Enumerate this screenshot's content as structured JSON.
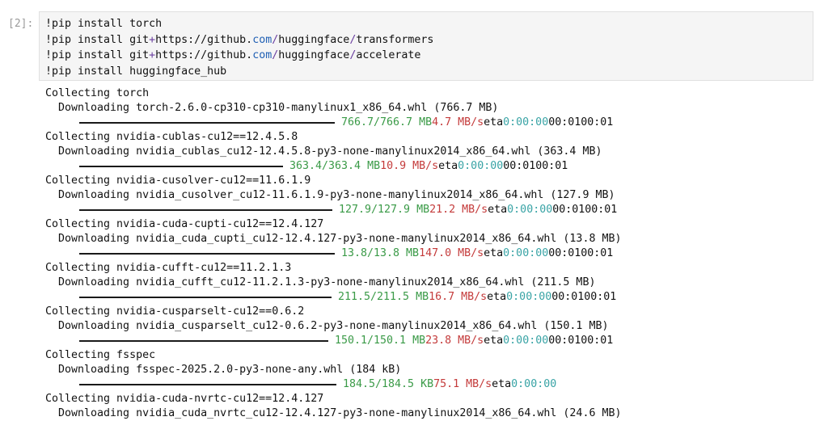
{
  "cell": {
    "prompt": "[2]:",
    "code_lines": [
      {
        "parts": [
          {
            "t": "!pip install torch",
            "c": ""
          }
        ]
      },
      {
        "parts": [
          {
            "t": "!pip install git",
            "c": ""
          },
          {
            "t": "+",
            "c": "plus"
          },
          {
            "t": "https://github.",
            "c": ""
          },
          {
            "t": "com",
            "c": "com"
          },
          {
            "t": "/",
            "c": "slash"
          },
          {
            "t": "huggingface",
            "c": ""
          },
          {
            "t": "/",
            "c": "slash"
          },
          {
            "t": "transformers",
            "c": ""
          }
        ]
      },
      {
        "parts": [
          {
            "t": "!pip install git",
            "c": ""
          },
          {
            "t": "+",
            "c": "plus"
          },
          {
            "t": "https://github.",
            "c": ""
          },
          {
            "t": "com",
            "c": "com"
          },
          {
            "t": "/",
            "c": "slash"
          },
          {
            "t": "huggingface",
            "c": ""
          },
          {
            "t": "/",
            "c": "slash"
          },
          {
            "t": "accelerate",
            "c": ""
          }
        ]
      },
      {
        "parts": [
          {
            "t": "!pip install huggingface_hub",
            "c": ""
          }
        ]
      }
    ]
  },
  "output": {
    "packages": [
      {
        "collecting": "Collecting torch",
        "downloading": "Downloading torch-2.6.0-cp310-cp310-manylinux1_x86_64.whl (766.7 MB)",
        "progress": "766.7/766.7 MB",
        "speed": "4.7 MB/s",
        "eta_label": "eta",
        "eta": "0:00:00",
        "tail": "00:0100:01"
      },
      {
        "collecting": "Collecting nvidia-cublas-cu12==12.4.5.8",
        "downloading": "Downloading nvidia_cublas_cu12-12.4.5.8-py3-none-manylinux2014_x86_64.whl (363.4 MB)",
        "progress": "363.4/363.4 MB",
        "speed": "10.9 MB/s",
        "eta_label": "eta",
        "eta": "0:00:00",
        "tail": "00:0100:01"
      },
      {
        "collecting": "Collecting nvidia-cusolver-cu12==11.6.1.9",
        "downloading": "Downloading nvidia_cusolver_cu12-11.6.1.9-py3-none-manylinux2014_x86_64.whl (127.9 MB)",
        "progress": "127.9/127.9 MB",
        "speed": "21.2 MB/s",
        "eta_label": "eta",
        "eta": "0:00:00",
        "tail": "00:0100:01"
      },
      {
        "collecting": "Collecting nvidia-cuda-cupti-cu12==12.4.127",
        "downloading": "Downloading nvidia_cuda_cupti_cu12-12.4.127-py3-none-manylinux2014_x86_64.whl (13.8 MB)",
        "progress": "13.8/13.8 MB",
        "speed": "147.0 MB/s",
        "eta_label": "eta",
        "eta": "0:00:00",
        "tail": "00:0100:01"
      },
      {
        "collecting": "Collecting nvidia-cufft-cu12==11.2.1.3",
        "downloading": "Downloading nvidia_cufft_cu12-11.2.1.3-py3-none-manylinux2014_x86_64.whl (211.5 MB)",
        "progress": "211.5/211.5 MB",
        "speed": "16.7 MB/s",
        "eta_label": "eta",
        "eta": "0:00:00",
        "tail": "00:0100:01"
      },
      {
        "collecting": "Collecting nvidia-cusparselt-cu12==0.6.2",
        "downloading": "Downloading nvidia_cusparselt_cu12-0.6.2-py3-none-manylinux2014_x86_64.whl (150.1 MB)",
        "progress": "150.1/150.1 MB",
        "speed": "23.8 MB/s",
        "eta_label": "eta",
        "eta": "0:00:00",
        "tail": "00:0100:01"
      },
      {
        "collecting": "Collecting fsspec",
        "downloading": "Downloading fsspec-2025.2.0-py3-none-any.whl (184 kB)",
        "progress": "184.5/184.5 KB",
        "speed": "75.1 MB/s",
        "eta_label": "eta",
        "eta": "0:00:00",
        "tail": ""
      },
      {
        "collecting": "Collecting nvidia-cuda-nvrtc-cu12==12.4.127",
        "downloading": "Downloading nvidia_cuda_nvrtc_cu12-12.4.127-py3-none-manylinux2014_x86_64.whl (24.6 MB)",
        "progress": "",
        "speed": "",
        "eta_label": "",
        "eta": "",
        "tail": ""
      }
    ]
  },
  "colors": {
    "progress_done": "#3a9a47",
    "speed": "#c43b3b",
    "eta": "#38a3a5",
    "cell_bg": "#f5f5f5"
  }
}
